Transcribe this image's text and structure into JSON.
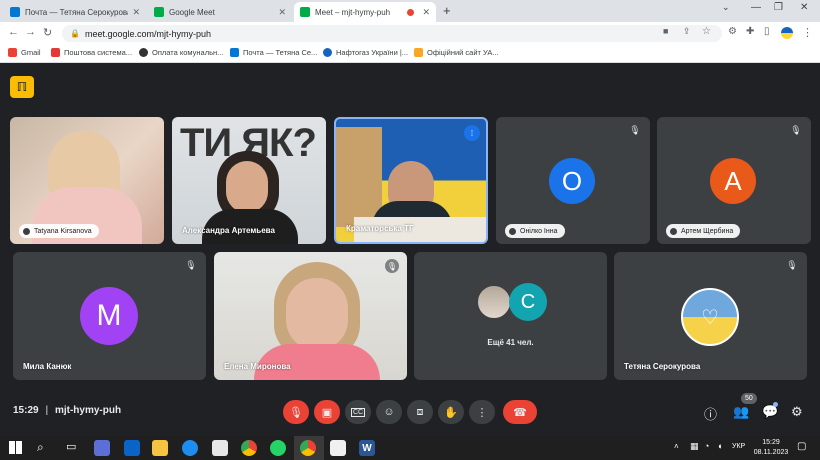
{
  "tabs": [
    {
      "title": "Почта — Тетяна Серокурова –",
      "favicon_color": "#0078d4"
    },
    {
      "title": "Google Meet",
      "favicon_color": "#00ac47"
    },
    {
      "title": "Meet – mjt-hymy-puh",
      "favicon_color": "#00ac47",
      "recording": true
    }
  ],
  "address": {
    "url": "meet.google.com/mjt-hymy-puh"
  },
  "bookmarks": [
    {
      "label": "Gmail",
      "color": "#ea4335"
    },
    {
      "label": "Поштова система...",
      "color": "#e53935"
    },
    {
      "label": "Оплата комунальн...",
      "color": "#333333"
    },
    {
      "label": "Почта — Тетяна Се...",
      "color": "#0078d4"
    },
    {
      "label": "Нафтогаз України |...",
      "color": "#1565c0"
    },
    {
      "label": "Офіційний сайт УА...",
      "color": "#f9a825"
    }
  ],
  "participants": [
    {
      "name": "Tatyana Kirsanova"
    },
    {
      "name": "Александра Артемьева"
    },
    {
      "name": "Краматорська ТГ"
    },
    {
      "name": "Онілко Інна",
      "initial": "О",
      "color": "#1a73e8"
    },
    {
      "name": "Артем Щербина",
      "initial": "А",
      "color": "#e8591a"
    },
    {
      "name": "Мила Канюк",
      "initial": "М",
      "color": "#a142f4"
    },
    {
      "name": "Елена Миронова"
    },
    {
      "name": "Ещё 41 чел.",
      "initial": "С",
      "color": "#12a4af"
    },
    {
      "name": "Тетяна Серокурова"
    }
  ],
  "meeting": {
    "time": "15:29",
    "separator": "|",
    "code": "mjt-hymy-puh",
    "people_count": "50"
  },
  "taskbar": {
    "lang": "УКР",
    "time": "15:29",
    "date": "08.11.2023"
  },
  "icons": {
    "logo": "meet-logo-icon"
  }
}
